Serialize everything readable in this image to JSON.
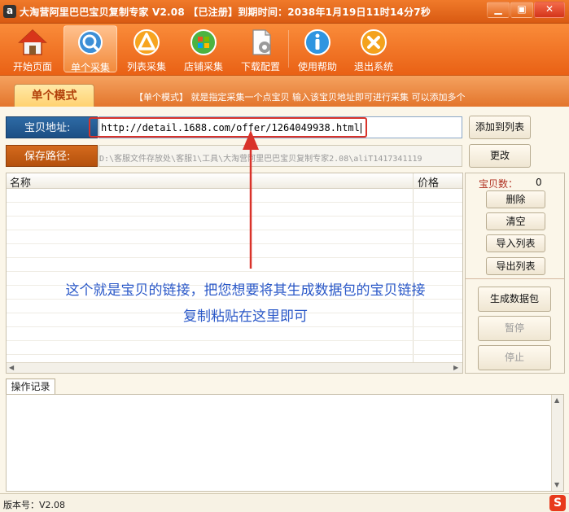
{
  "window": {
    "title": "大淘营阿里巴巴宝贝复制专家 V2.08 【已注册】到期时间：2038年1月19日11时14分7秒",
    "min": "▁",
    "max": "▣",
    "close": "✕"
  },
  "toolbar": {
    "items": [
      {
        "label": "开始页面",
        "icon": "home-icon"
      },
      {
        "label": "单个采集",
        "icon": "magnifier-icon",
        "active": true
      },
      {
        "label": "列表采集",
        "icon": "list-collect-icon"
      },
      {
        "label": "店铺采集",
        "icon": "shop-collect-icon"
      },
      {
        "label": "下载配置",
        "icon": "download-config-icon"
      },
      {
        "label": "使用帮助",
        "icon": "help-icon"
      },
      {
        "label": "退出系统",
        "icon": "exit-icon"
      }
    ]
  },
  "mode": {
    "tab": "单个模式",
    "description": "【单个模式】 就是指定采集一个点宝贝 输入该宝贝地址即可进行采集 可以添加多个"
  },
  "address": {
    "label": "宝贝地址:",
    "value": "http://detail.1688.com/offer/1264049938.html",
    "add_button": "添加到列表"
  },
  "save": {
    "label": "保存路径:",
    "value": "D:\\客服文件存放处\\客服1\\工具\\大淘营阿里巴巴宝贝复制专家2.08\\aliT1417341119",
    "change_button": "更改"
  },
  "list": {
    "columns": [
      "名称",
      "价格"
    ],
    "rows": []
  },
  "annotation": {
    "line1": "这个就是宝贝的链接，把您想要将其生成数据包的宝贝链接",
    "line2": "复制粘贴在这里即可"
  },
  "panel": {
    "count_label": "宝贝数：",
    "count_value": "0",
    "delete": "删除",
    "clear": "清空",
    "import": "导入列表",
    "export": "导出列表",
    "generate": "生成数据包",
    "pause": "暂停",
    "stop": "停止"
  },
  "log": {
    "tab": "操作记录"
  },
  "status": {
    "version": "版本号：V2.08"
  },
  "colors": {
    "title_orange": "#e96115",
    "address_blue": "#2d6aa5",
    "save_orange": "#c45a14",
    "annotation_blue": "#2a58c8",
    "highlight_red": "#d9332a"
  }
}
